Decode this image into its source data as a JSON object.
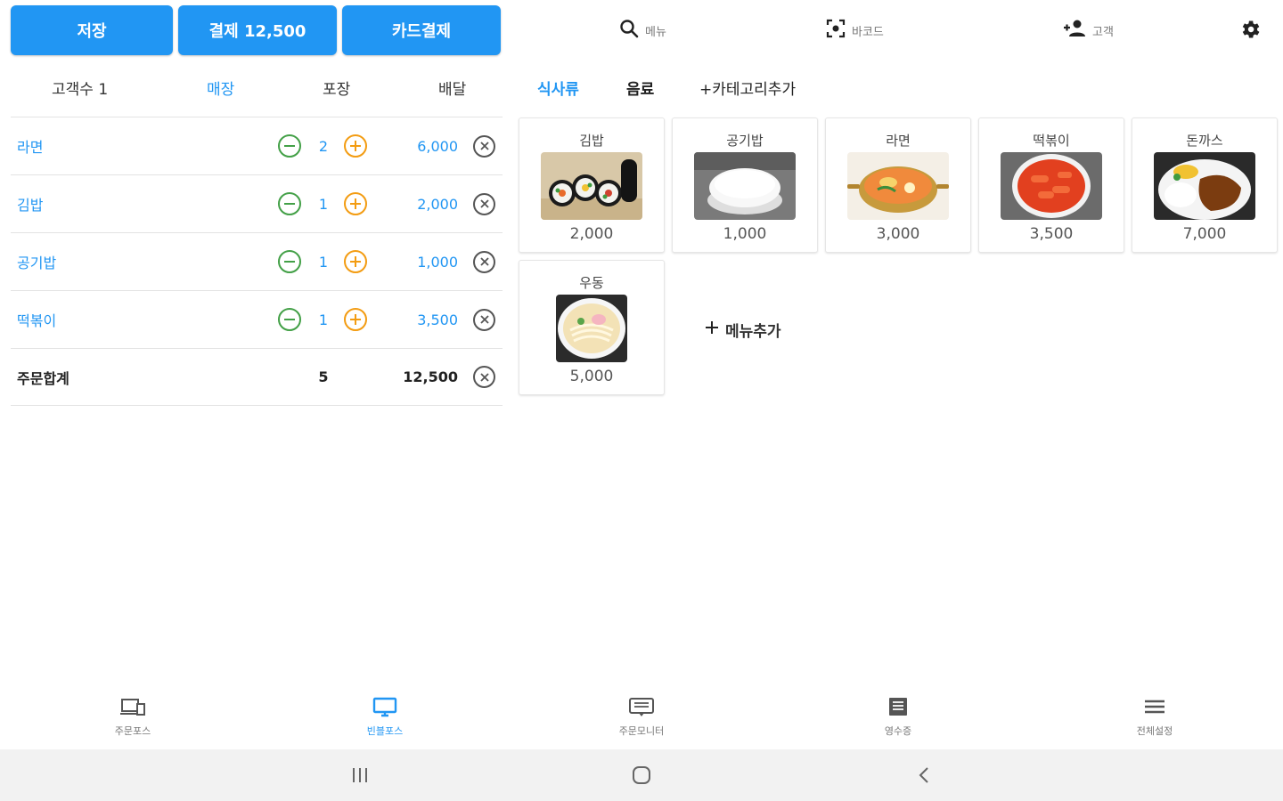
{
  "top_buttons": {
    "save": "저장",
    "pay": "결제 12,500",
    "card": "카드결제"
  },
  "order_tabs": {
    "customer_count": "고객수 1",
    "tabs": [
      "매장",
      "포장",
      "배달"
    ],
    "active": "매장"
  },
  "order_items": [
    {
      "name": "라면",
      "qty": "2",
      "price": "6,000"
    },
    {
      "name": "김밥",
      "qty": "1",
      "price": "2,000"
    },
    {
      "name": "공기밥",
      "qty": "1",
      "price": "1,000"
    },
    {
      "name": "떡볶이",
      "qty": "1",
      "price": "3,500"
    }
  ],
  "order_total": {
    "label": "주문합계",
    "qty": "5",
    "price": "12,500"
  },
  "toolbar": {
    "search": "메뉴",
    "barcode": "바코드",
    "customer": "고객"
  },
  "categories": {
    "items": [
      "식사류",
      "음료",
      "+카테고리추가"
    ],
    "active": "식사류"
  },
  "menu_items": [
    {
      "name": "김밥",
      "price": "2,000",
      "image": "kimbap"
    },
    {
      "name": "공기밥",
      "price": "1,000",
      "image": "rice"
    },
    {
      "name": "라면",
      "price": "3,000",
      "image": "ramen"
    },
    {
      "name": "떡볶이",
      "price": "3,500",
      "image": "tteokbokki"
    },
    {
      "name": "돈까스",
      "price": "7,000",
      "image": "donkatsu"
    },
    {
      "name": "우동",
      "price": "5,000",
      "image": "udon"
    }
  ],
  "add_menu_label": "메뉴추가",
  "bottom_nav": [
    {
      "label": "주문포스",
      "icon": "devices-icon",
      "active": false
    },
    {
      "label": "빈블포스",
      "icon": "monitor-icon",
      "active": true
    },
    {
      "label": "주문모니터",
      "icon": "message-icon",
      "active": false
    },
    {
      "label": "영수증",
      "icon": "receipt-icon",
      "active": false
    },
    {
      "label": "전체설정",
      "icon": "menu-icon",
      "active": false
    }
  ],
  "colors": {
    "accent": "#2196f3",
    "minus": "#43a047",
    "plus": "#f39c12"
  }
}
